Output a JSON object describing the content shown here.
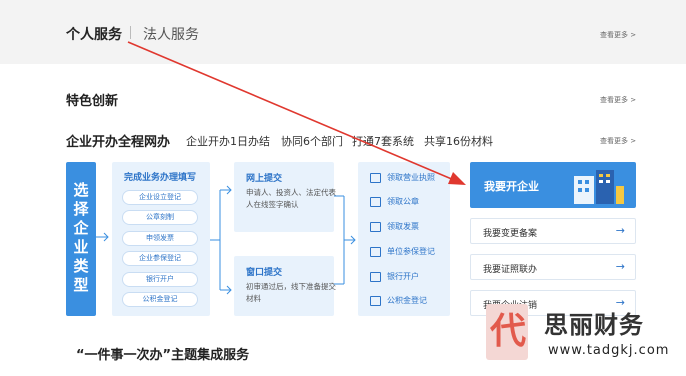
{
  "top_tabs": {
    "personal": "个人服务",
    "corporate": "法人服务"
  },
  "see_more": "查看更多 >",
  "sections": {
    "featured": "特色创新",
    "one_network": {
      "title": "企业开办全程网办",
      "tags": [
        "企业开办1日办结",
        "协同6个部门",
        "打通7套系统",
        "共享16份材料"
      ]
    },
    "bottom": "“一件事一次办”主题集成服务"
  },
  "choose_type": "选择企业类型",
  "step1": {
    "title": "完成业务办理填写",
    "items": [
      "企业设立登记",
      "公章刻制",
      "申领发票",
      "企业参保登记",
      "银行开户",
      "公积金登记"
    ]
  },
  "step_online": {
    "title": "网上提交",
    "desc": "申请人、投资人、法定代表人在线签字确认"
  },
  "step_window": {
    "title": "窗口提交",
    "desc": "初审通过后，线下准备提交材料"
  },
  "results": [
    "领取营业执照",
    "领取公章",
    "领取发票",
    "单位参保登记",
    "银行开户",
    "公积金登记"
  ],
  "actions": {
    "open": "我要开企业",
    "list": [
      {
        "label": "我要变更备案",
        "arrow": "→"
      },
      {
        "label": "我要证照联办",
        "arrow": "→"
      },
      {
        "label": "我要企业注销",
        "arrow": "→"
      }
    ]
  },
  "watermark": {
    "name": "思丽财务",
    "url": "www.tadgkj.com",
    "logo_char": "代"
  },
  "colors": {
    "accent": "#3a8fe0",
    "arrow": "#e0382f",
    "panel": "#e8f2fc"
  }
}
